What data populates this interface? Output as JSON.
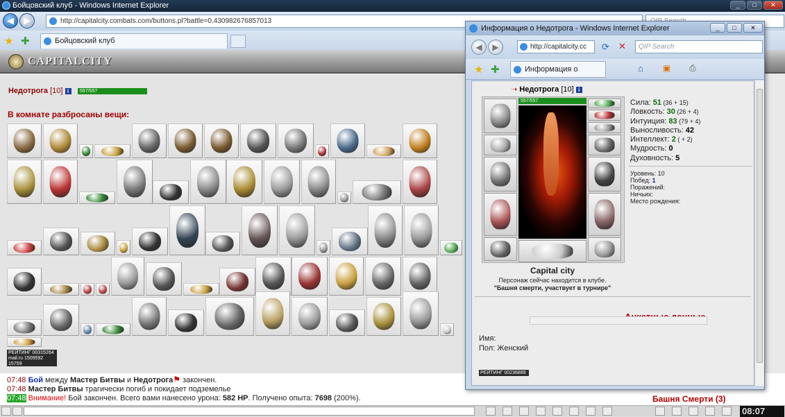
{
  "main_window": {
    "title": "Бойцовский клуб - Windows Internet Explorer",
    "address": "http://capitalcity.combats.com/buttons.pl?battle=0.430982676857013",
    "search_placeholder": "QIP Search",
    "tab_label": "Бойцовский клуб"
  },
  "game": {
    "logo": "CAPITALCITY",
    "player_name": "Недотрога",
    "player_level": "[10]",
    "hp": "557/557",
    "things_title": "В комнате разбросаны вещи:",
    "counter_lines": [
      "РЕЙТИНГ 00315264",
      "mail.ru 1509592",
      "15759"
    ]
  },
  "chat": {
    "lines": [
      {
        "time": "07:48",
        "parts": [
          "Бой",
          " между ",
          "Мастер Битвы",
          " и ",
          "Недотрога",
          " закончен."
        ]
      },
      {
        "time": "07:48",
        "parts": [
          "Мастер Битвы",
          " трагически погиб и покидает подземелье"
        ]
      },
      {
        "time": "07:48",
        "parts": [
          "Внимание!",
          " Бой закончен. Всего вами нанесено урона: ",
          "582 HP",
          ". Получено опыта: ",
          "7698",
          " (200%)."
        ]
      }
    ],
    "location": "Башня Смерти (3)",
    "clock": "08:07"
  },
  "popup": {
    "title": "Информация о Недотрога - Windows Internet Explorer",
    "address": "http://capitalcity.cc",
    "search_placeholder": "QIP Search",
    "tab_label": "Информация о Недотр...",
    "char_name": "Недотрога",
    "char_level": "[10]",
    "hp": "557/557",
    "city": "Capital city",
    "status_line1": "Персонаж сейчас находится в клубе.",
    "status_line2": "\"Башня смерти, участвует в турнире\"",
    "stats": [
      {
        "label": "Сила: ",
        "value": "51",
        "sub": " (36 + 15)"
      },
      {
        "label": "Ловкость: ",
        "value": "30",
        "sub": " (26 + 4)"
      },
      {
        "label": "Интуиция: ",
        "value": "83",
        "sub": " (79 + 4)"
      },
      {
        "label": "Выносливость: ",
        "value": "42",
        "sub": ""
      },
      {
        "label": "Интеллект: ",
        "value": "2",
        "sub": " ( + 2)"
      },
      {
        "label": "Мудрость: ",
        "value": "0",
        "sub": ""
      },
      {
        "label": "Духовность: ",
        "value": "5",
        "sub": ""
      }
    ],
    "info": [
      {
        "label": "Уровень: ",
        "value": "10"
      },
      {
        "label": "Побед: ",
        "value": "1"
      },
      {
        "label": "Поражений: ",
        "value": ""
      },
      {
        "label": "Ничьих: ",
        "value": ""
      },
      {
        "label": "Место рождения: ",
        "value": ""
      }
    ],
    "profile_title": "Анкетные данные",
    "name_label": "Имя:",
    "sex_label": "Пол: Женский",
    "counter": "РЕЙТИНГ 00236889"
  }
}
